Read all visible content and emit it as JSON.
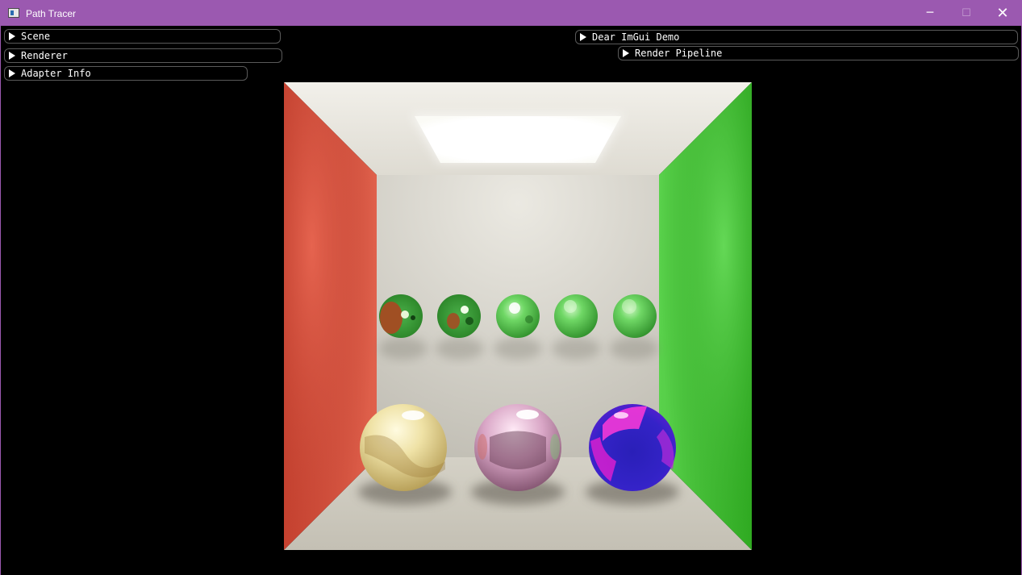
{
  "window": {
    "title": "Path Tracer",
    "minimize_glyph": "─",
    "maximize_glyph": "☐",
    "close_glyph": "✕"
  },
  "panels": {
    "scene": "Scene",
    "renderer": "Renderer",
    "adapter_info": "Adapter Info",
    "imgui_demo": "Dear ImGui Demo",
    "render_pipeline": "Render Pipeline"
  },
  "colors": {
    "titlebar": "#9b59b0",
    "left_wall": "#d14a3a",
    "right_wall": "#3fbf2f",
    "back_wall": "#dcdad2",
    "light": "#ffffff"
  },
  "icons": {
    "app": "window-icon",
    "expand": "triangle-right-icon"
  }
}
